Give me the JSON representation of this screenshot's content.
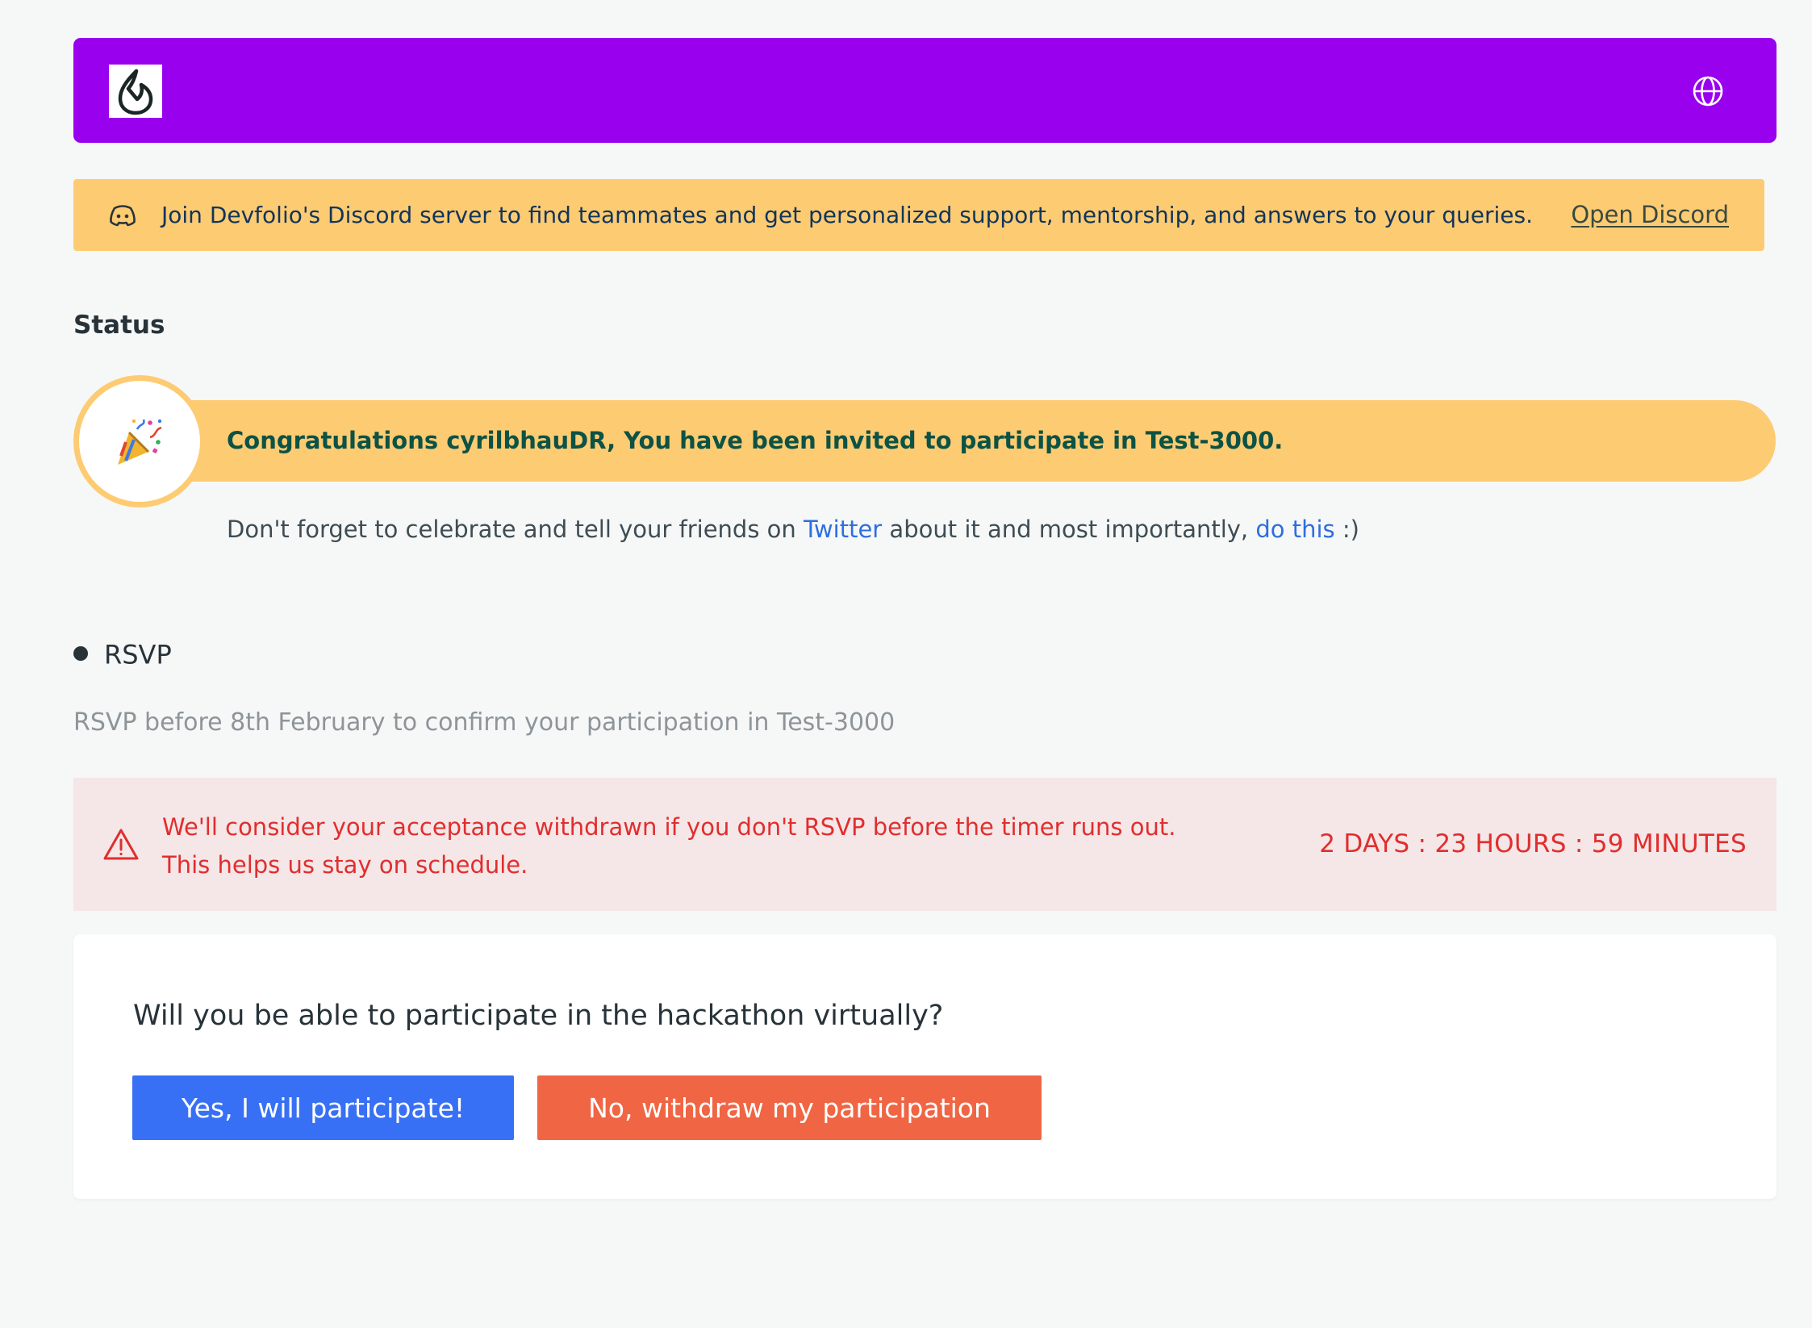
{
  "header": {
    "logo_icon": "devfolio-drop-logo-icon",
    "language_icon": "globe-icon",
    "brand_color": "#9900ee"
  },
  "discord_banner": {
    "icon": "discord-icon",
    "message": "Join Devfolio's Discord server to find teammates and get personalized support, mentorship, and answers to your queries.",
    "link_label": "Open Discord",
    "background_color": "#fdcb72"
  },
  "status": {
    "title": "Status",
    "badge_icon": "party-popper-icon",
    "invite_message": "Congratulations cyrilbhauDR, You have been invited to participate in Test-3000.",
    "celebrate": {
      "before_twitter": "Don't forget to celebrate and tell your friends on ",
      "twitter_label": "Twitter",
      "middle": " about it and most importantly, ",
      "do_this_label": "do this",
      "after": " :)"
    }
  },
  "rsvp": {
    "step_label": "RSVP",
    "deadline_text": "RSVP before 8th February to confirm your participation in Test-3000",
    "warning": {
      "icon": "warning-triangle-icon",
      "line1": "We'll consider your acceptance withdrawn if you don't RSVP before the timer runs out.",
      "line2": "This helps us stay on schedule.",
      "timer": "2 DAYS : 23 HOURS : 59 MINUTES",
      "text_color": "#e02e2e"
    }
  },
  "question": {
    "text": "Will you be able to participate in the hackathon virtually?",
    "yes_label": "Yes, I will participate!",
    "no_label": "No, withdraw my participation",
    "yes_color": "#3770f5",
    "no_color": "#f06543"
  }
}
